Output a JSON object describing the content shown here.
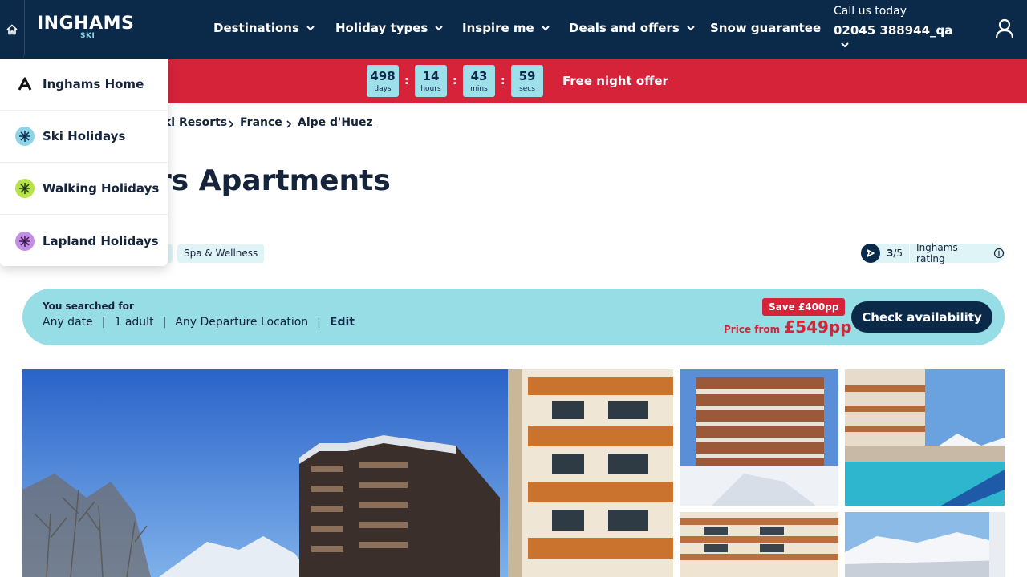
{
  "header": {
    "logo_text": "INGHAMS",
    "logo_sub": "SKI",
    "nav": [
      {
        "label": "Destinations"
      },
      {
        "label": "Holiday types"
      },
      {
        "label": "Inspire me"
      },
      {
        "label": "Deals and offers"
      },
      {
        "label": "Snow guarantee"
      }
    ],
    "call_label": "Call us today",
    "call_phone": "02045 388944_qa"
  },
  "promo": {
    "countdown": [
      {
        "value": "498",
        "unit": "days"
      },
      {
        "value": "14",
        "unit": "hours"
      },
      {
        "value": "43",
        "unit": "mins"
      },
      {
        "value": "59",
        "unit": "secs"
      }
    ],
    "separator": ":",
    "offer_text": "Free night offer"
  },
  "breadcrumb": {
    "items": [
      "ki Resorts",
      "France",
      "Alpe d'Huez"
    ]
  },
  "page_title": "rs Apartments",
  "tags": [
    "Spa & Wellness"
  ],
  "rating": {
    "score": "3",
    "out_of": "/5",
    "label": "Inghams rating"
  },
  "search_summary": {
    "label": "You searched for",
    "date": "Any date",
    "guests": "1 adult",
    "departure": "Any Departure Location",
    "pipe": "|",
    "edit": "Edit",
    "save_badge": "Save £400pp",
    "price_label": "Price from",
    "price": "£549pp",
    "cta": "Check availability"
  },
  "menu": {
    "items": [
      {
        "label": "Inghams Home",
        "icon": "inghams-logo-icon"
      },
      {
        "label": "Ski Holidays",
        "icon": "snowflake-icon"
      },
      {
        "label": "Walking Holidays",
        "icon": "walking-icon"
      },
      {
        "label": "Lapland Holidays",
        "icon": "lapland-icon"
      }
    ]
  },
  "colors": {
    "navy": "#0b2a4a",
    "red": "#d6233a",
    "aqua": "#96dde6",
    "light_aqua": "#dff4f7"
  }
}
